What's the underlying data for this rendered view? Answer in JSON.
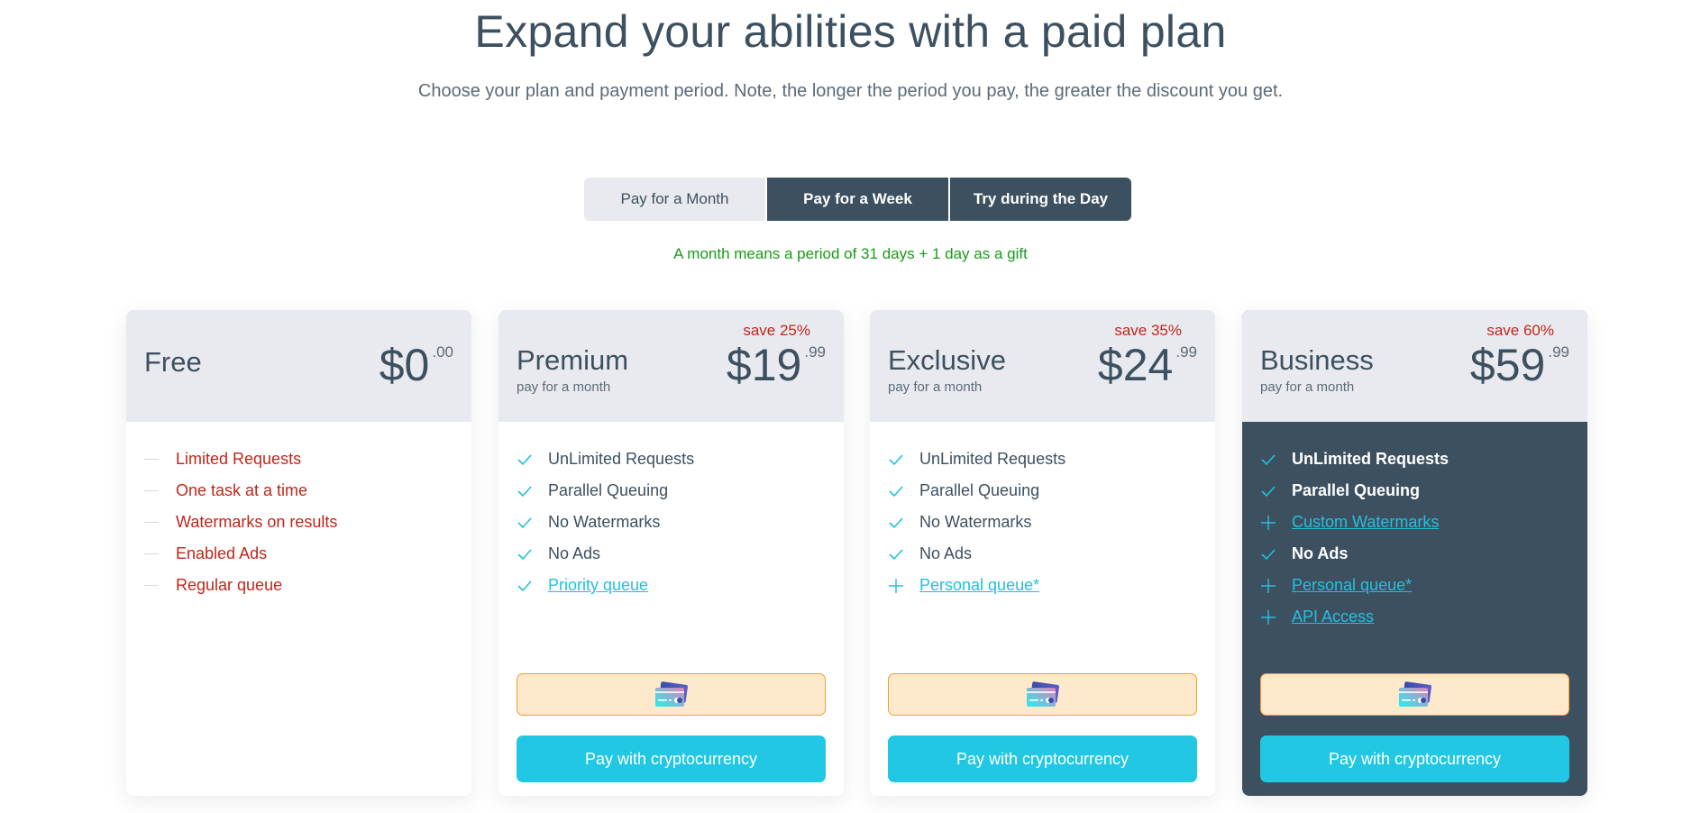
{
  "header": {
    "title": "Expand your abilities with a paid plan",
    "subtitle": "Choose your plan and payment period. Note, the longer the period you pay, the greater the discount you get."
  },
  "period_toggle": {
    "options": [
      {
        "label": "Pay for a Month",
        "state": "light"
      },
      {
        "label": "Pay for a Week",
        "state": "dark"
      },
      {
        "label": "Try during the Day",
        "state": "dark"
      }
    ]
  },
  "period_note": "A month means a period of 31 days + 1 day as a gift",
  "colors": {
    "primary_dark": "#3d5060",
    "accent_cyan": "#22c8e3",
    "negative_red": "#c0261a",
    "note_green": "#1a9a1a",
    "card_pay_bg": "#ffe9cc",
    "card_pay_border": "#f0a02a"
  },
  "plans": [
    {
      "name": "Free",
      "period": "",
      "save": "",
      "price_int": "$0",
      "price_cents": ".00",
      "features": [
        {
          "icon": "dash-icon",
          "label": "Limited Requests",
          "type": "neg"
        },
        {
          "icon": "dash-icon",
          "label": "One task at a time",
          "type": "neg"
        },
        {
          "icon": "dash-icon",
          "label": "Watermarks on results",
          "type": "neg"
        },
        {
          "icon": "dash-icon",
          "label": "Enabled Ads",
          "type": "neg"
        },
        {
          "icon": "dash-icon",
          "label": "Regular queue",
          "type": "neg"
        }
      ]
    },
    {
      "name": "Premium",
      "period": "pay for a month",
      "save": "save 25%",
      "price_int": "$19",
      "price_cents": ".99",
      "features": [
        {
          "icon": "check-icon",
          "label": "UnLimited Requests",
          "type": "plain"
        },
        {
          "icon": "check-icon",
          "label": "Parallel Queuing",
          "type": "plain"
        },
        {
          "icon": "check-icon",
          "label": "No Watermarks",
          "type": "plain"
        },
        {
          "icon": "check-icon",
          "label": "No Ads",
          "type": "plain"
        },
        {
          "icon": "check-icon",
          "label": "Priority queue",
          "type": "link"
        }
      ],
      "card_pay_icon": "credit-card-icon",
      "crypto_label": "Pay with cryptocurrency"
    },
    {
      "name": "Exclusive",
      "period": "pay for a month",
      "save": "save 35%",
      "price_int": "$24",
      "price_cents": ".99",
      "features": [
        {
          "icon": "check-icon",
          "label": "UnLimited Requests",
          "type": "plain"
        },
        {
          "icon": "check-icon",
          "label": "Parallel Queuing",
          "type": "plain"
        },
        {
          "icon": "check-icon",
          "label": "No Watermarks",
          "type": "plain"
        },
        {
          "icon": "check-icon",
          "label": "No Ads",
          "type": "plain"
        },
        {
          "icon": "plus-icon",
          "label": "Personal queue*",
          "type": "link"
        }
      ],
      "card_pay_icon": "credit-card-icon",
      "crypto_label": "Pay with cryptocurrency"
    },
    {
      "name": "Business",
      "period": "pay for a month",
      "save": "save 60%",
      "price_int": "$59",
      "price_cents": ".99",
      "features": [
        {
          "icon": "check-icon",
          "label": "UnLimited Requests",
          "type": "plain"
        },
        {
          "icon": "check-icon",
          "label": "Parallel Queuing",
          "type": "plain"
        },
        {
          "icon": "plus-icon",
          "label": "Custom Watermarks",
          "type": "link"
        },
        {
          "icon": "check-icon",
          "label": "No Ads",
          "type": "plain"
        },
        {
          "icon": "plus-icon",
          "label": "Personal queue*",
          "type": "link"
        },
        {
          "icon": "plus-icon",
          "label": "API Access",
          "type": "link"
        }
      ],
      "card_pay_icon": "credit-card-icon",
      "crypto_label": "Pay with cryptocurrency"
    }
  ]
}
